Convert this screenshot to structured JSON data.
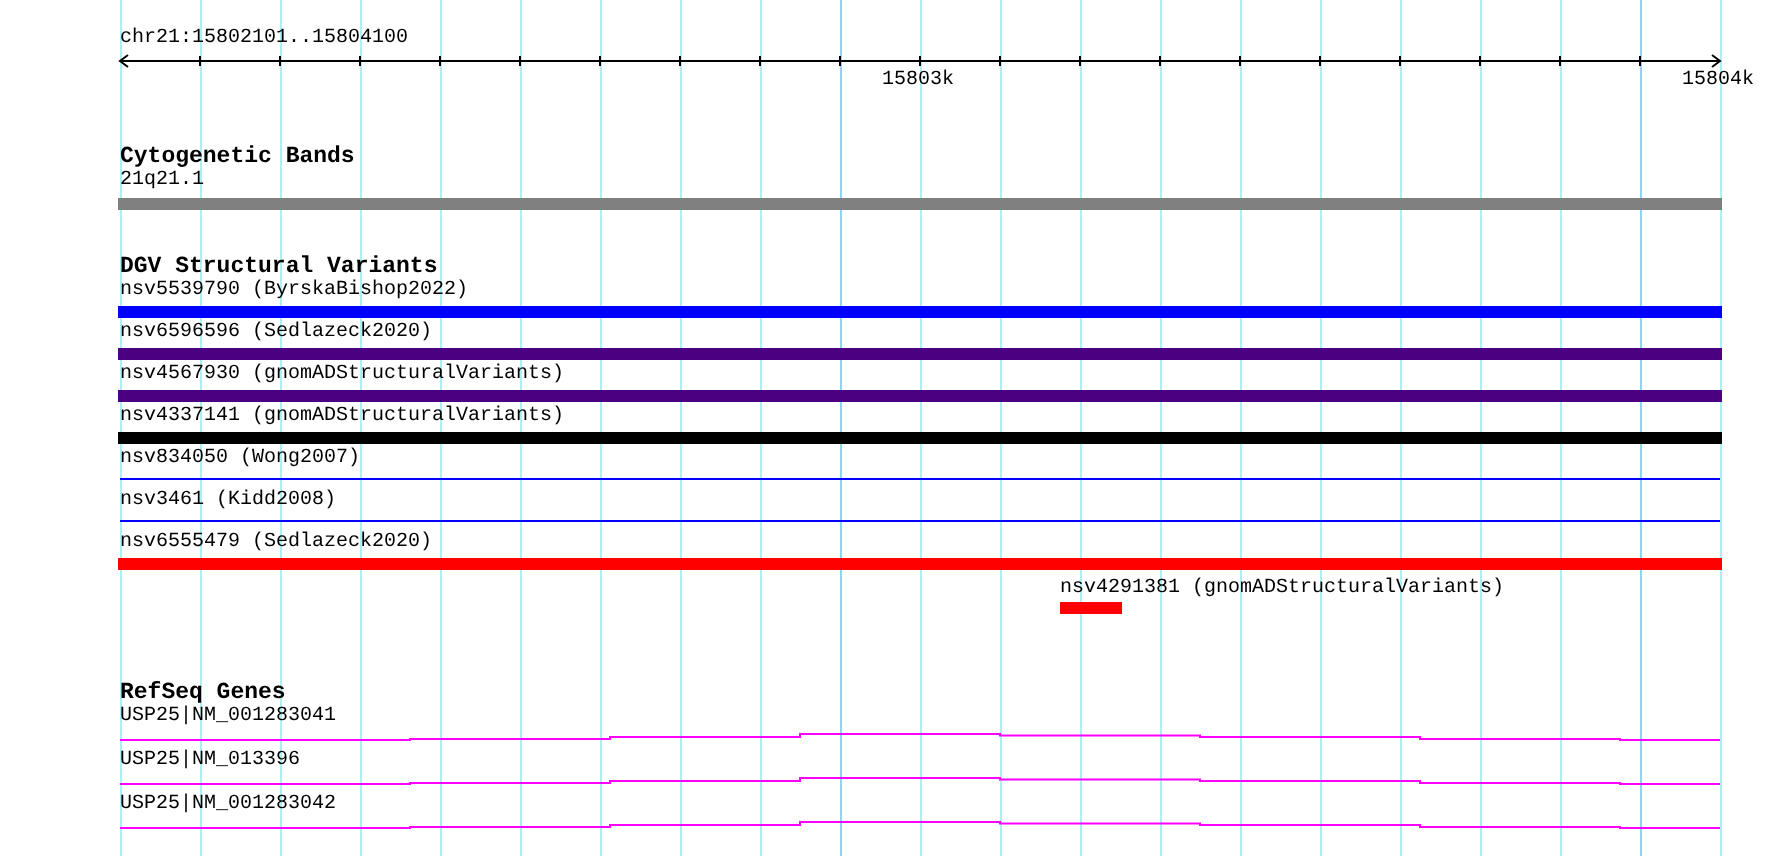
{
  "ruler": {
    "location": "chr21:15802101..15804100",
    "ticks": [
      {
        "label": "15803k"
      },
      {
        "label": "15804k"
      }
    ]
  },
  "tracks": [
    {
      "title": "Cytogenetic Bands",
      "kind": "band",
      "features": [
        {
          "label": "21q21.1",
          "color": "#808080",
          "kind": "thick"
        }
      ]
    },
    {
      "title": "DGV Structural Variants",
      "kind": "variant",
      "features": [
        {
          "label": "nsv5539790 (ByrskaBishop2022)",
          "color": "#0000ff",
          "kind": "thick"
        },
        {
          "label": "nsv6596596 (Sedlazeck2020)",
          "color": "#4b0082",
          "kind": "thick"
        },
        {
          "label": "nsv4567930 (gnomADStructuralVariants)",
          "color": "#4b0082",
          "kind": "thick"
        },
        {
          "label": "nsv4337141 (gnomADStructuralVariants)",
          "color": "#000000",
          "kind": "thick"
        },
        {
          "label": "nsv834050 (Wong2007)",
          "color": "#0000ff",
          "kind": "thin"
        },
        {
          "label": "nsv3461 (Kidd2008)",
          "color": "#0000ff",
          "kind": "thin"
        },
        {
          "label": "nsv6555479 (Sedlazeck2020)",
          "color": "#ff0000",
          "kind": "thick"
        },
        {
          "label": "nsv4291381 (gnomADStructuralVariants)",
          "color": "#ff0000",
          "kind": "local"
        }
      ]
    },
    {
      "title": "RefSeq Genes",
      "kind": "gene",
      "features": [
        {
          "label": "USP25|NM_001283041",
          "color": "#ff00ff",
          "kind": "gene"
        },
        {
          "label": "USP25|NM_013396",
          "color": "#ff00ff",
          "kind": "gene"
        },
        {
          "label": "USP25|NM_001283042",
          "color": "#ff00ff",
          "kind": "gene"
        }
      ]
    }
  ]
}
